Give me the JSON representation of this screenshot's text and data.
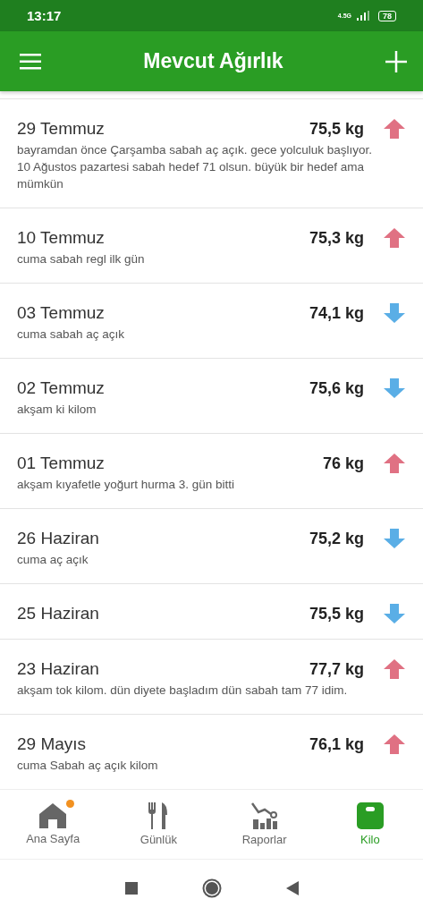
{
  "status_bar": {
    "time": "13:17",
    "network": "4.5G",
    "battery": "78"
  },
  "app_bar": {
    "title": "Mevcut Ağırlık"
  },
  "entries": [
    {
      "date": "29 Temmuz",
      "weight": "75,5 kg",
      "kind": "up",
      "note": "bayramdan önce Çarşamba sabah aç açık. gece yolculuk başlıyor. 10 Ağustos pazartesi sabah hedef 71 olsun. büyük bir hedef ama mümkün"
    },
    {
      "date": "10 Temmuz",
      "weight": "75,3 kg",
      "kind": "up",
      "note": "cuma sabah regl ilk gün"
    },
    {
      "date": "03 Temmuz",
      "weight": "74,1 kg",
      "kind": "down",
      "note": "cuma sabah aç açık"
    },
    {
      "date": "02 Temmuz",
      "weight": "75,6 kg",
      "kind": "down",
      "note": "akşam ki kilom"
    },
    {
      "date": "01 Temmuz",
      "weight": "76 kg",
      "kind": "up",
      "note": "akşam kıyafetle yoğurt hurma 3. gün bitti"
    },
    {
      "date": "26 Haziran",
      "weight": "75,2 kg",
      "kind": "down",
      "note": "cuma aç açık"
    },
    {
      "date": "25 Haziran",
      "weight": "75,5 kg",
      "kind": "down"
    },
    {
      "date": "23 Haziran",
      "weight": "77,7 kg",
      "kind": "up",
      "note": "akşam tok kilom. dün diyete başladım dün sabah tam 77 idim."
    },
    {
      "date": "29 Mayıs",
      "weight": "76,1 kg",
      "kind": "up",
      "note": "cuma Sabah aç açık kilom"
    }
  ],
  "bottom_nav": [
    {
      "label": "Ana Sayfa",
      "kind": "home",
      "selected": false,
      "dot": true
    },
    {
      "label": "Günlük",
      "kind": "diary",
      "selected": false,
      "dot": false
    },
    {
      "label": "Raporlar",
      "kind": "reports",
      "selected": false,
      "dot": false
    },
    {
      "label": "Kilo",
      "kind": "scale",
      "selected": true,
      "dot": false
    }
  ]
}
